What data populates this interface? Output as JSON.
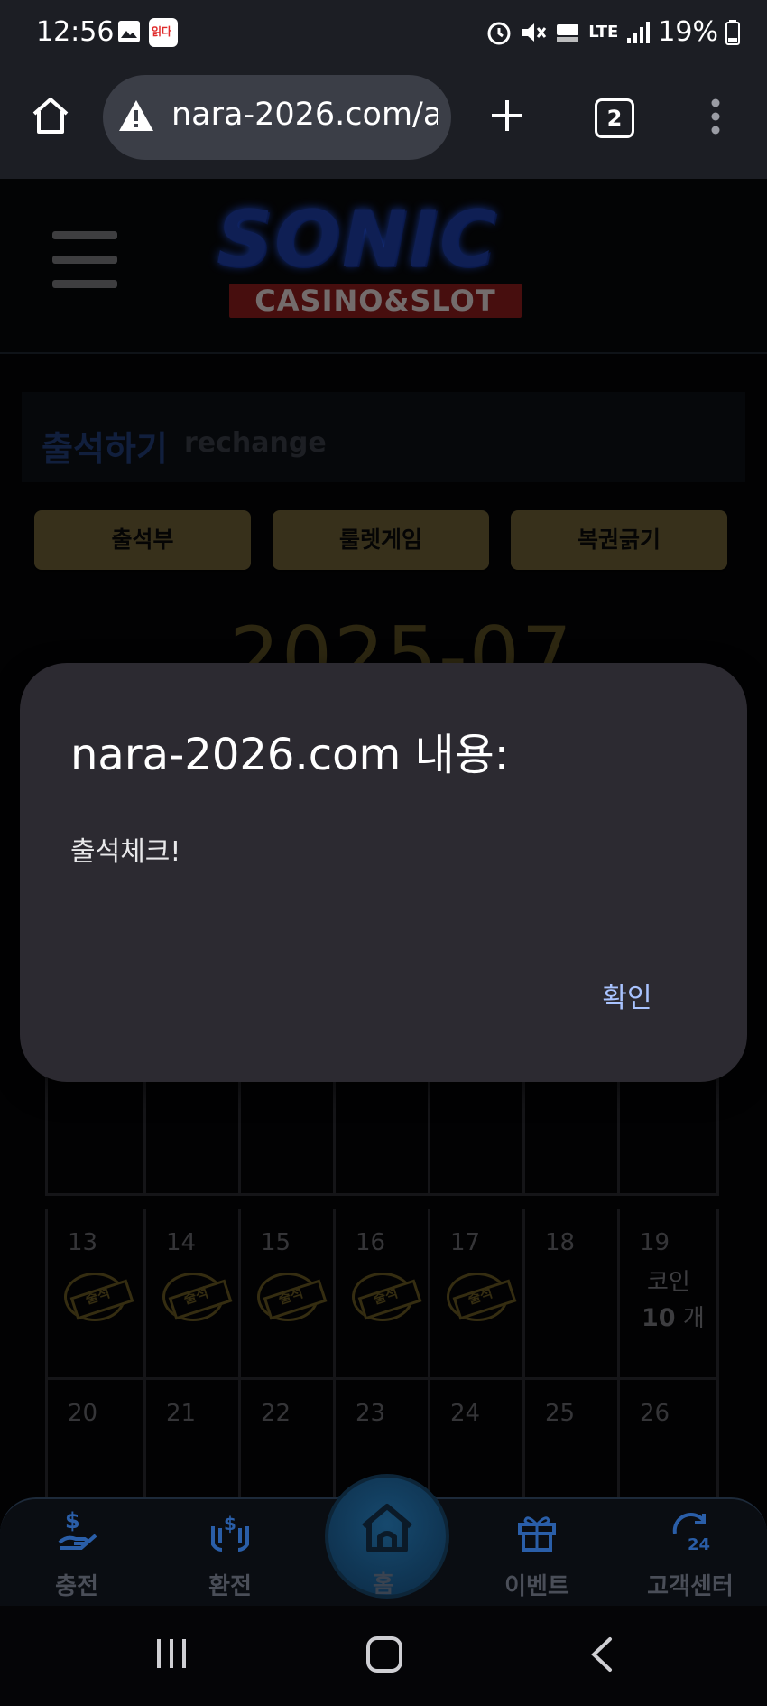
{
  "status_bar": {
    "time": "12:56",
    "notification_badge": "읽다",
    "network": "LTE",
    "battery": "19%"
  },
  "browser": {
    "url": "nara-2026.com/a",
    "tab_count": "2"
  },
  "site": {
    "logo_main": "SONIC",
    "logo_sub": "CASINO&SLOT"
  },
  "section": {
    "title": "출석하기",
    "subtitle": "rechange"
  },
  "tabs": [
    {
      "label": "출석부"
    },
    {
      "label": "룰렛게임"
    },
    {
      "label": "복권긁기"
    }
  ],
  "calendar": {
    "month": "2025-07",
    "stamp_text": "출석",
    "rows": [
      [
        {
          "day": "",
          "stamped": true
        },
        {
          "day": "",
          "stamped": true
        },
        {
          "day": "",
          "stamped": true
        },
        {
          "day": "",
          "stamped": true
        },
        {
          "day": "",
          "stamped": true
        },
        {
          "day": "",
          "stamped": true
        },
        {
          "day": "",
          "stamped": true
        }
      ],
      [
        {
          "day": "13",
          "stamped": true
        },
        {
          "day": "14",
          "stamped": true
        },
        {
          "day": "15",
          "stamped": true
        },
        {
          "day": "16",
          "stamped": true
        },
        {
          "day": "17",
          "stamped": true
        },
        {
          "day": "18",
          "stamped": false
        },
        {
          "day": "19",
          "stamped": false,
          "coin_label": "코인",
          "coin_amount": "10",
          "coin_unit": "개"
        }
      ],
      [
        {
          "day": "20",
          "stamped": false
        },
        {
          "day": "21",
          "stamped": false
        },
        {
          "day": "22",
          "stamped": false
        },
        {
          "day": "23",
          "stamped": false
        },
        {
          "day": "24",
          "stamped": false
        },
        {
          "day": "25",
          "stamped": false
        },
        {
          "day": "26",
          "stamped": false
        }
      ]
    ]
  },
  "dialog": {
    "title": "nara-2026.com 내용:",
    "message": "출석체크!",
    "ok_label": "확인"
  },
  "bottom_nav": [
    {
      "label": "충전",
      "icon": "deposit-icon"
    },
    {
      "label": "환전",
      "icon": "exchange-icon"
    },
    {
      "label": "홈",
      "icon": "home-icon"
    },
    {
      "label": "이벤트",
      "icon": "gift-icon"
    },
    {
      "label": "고객센터",
      "icon": "support-24-icon"
    }
  ],
  "colors": {
    "accent_blue": "#1f3fa8",
    "button_gold": "#6e6136",
    "dialog_bg": "#2c2a31",
    "dialog_button": "#a9c3ff"
  }
}
